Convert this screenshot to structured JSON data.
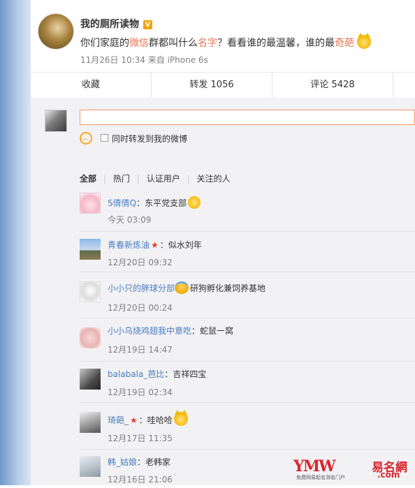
{
  "post": {
    "author": "我的厕所读物",
    "verified_badge": "V",
    "text_parts": [
      {
        "t": "你们家庭的",
        "hl": false
      },
      {
        "t": "微信",
        "hl": true
      },
      {
        "t": "群都叫什么",
        "hl": false
      },
      {
        "t": "名字",
        "hl": true
      },
      {
        "t": "？看看谁的最温馨，谁的最",
        "hl": false
      },
      {
        "t": "奇葩",
        "hl": true
      }
    ],
    "meta": "11月26日 10:34 来自 iPhone 6s",
    "actions": [
      "收藏",
      "转发 1056",
      "评论 5428"
    ]
  },
  "compose": {
    "input_value": "",
    "repost_label": "同时转发到我的微博",
    "repost_checked": false
  },
  "filters": {
    "items": [
      "全部",
      "热门",
      "认证用户",
      "关注的人"
    ],
    "active_index": 0
  },
  "comments": [
    {
      "name": "S倩倩Q",
      "text": "：东平党支部",
      "time": "今天 03:09",
      "emoji_after": "laugh-emoji",
      "star": false
    },
    {
      "name": "青春新炼油",
      "text": "：似水刘年",
      "time": "12月20日 09:32",
      "emoji_after": "",
      "star": true
    },
    {
      "name": "小小只的胖球分部",
      "text": "研狗孵化兼饲养基地",
      "time": "12月20日 00:24",
      "emoji_before": "hug-emoji",
      "star": false
    },
    {
      "name": "小小乌烧鸡翅我中意吃",
      "text": "：蛇鼠一窝",
      "time": "12月19日 14:47",
      "emoji_after": "",
      "star": false
    },
    {
      "name": "balabala_芭比",
      "text": "：吉祥四宝",
      "time": "12月19日 02:34",
      "emoji_after": "",
      "star": false
    },
    {
      "name": "琦葩_",
      "text": "：哇哈哈",
      "time": "12月17日 11:35",
      "emoji_after": "cat-emoji",
      "star": true
    },
    {
      "name": "韩_姑娘",
      "text": "：老韩家",
      "time": "12月16日 21:06",
      "emoji_after": "",
      "star": false
    }
  ],
  "watermark": {
    "main": "YMW",
    "cn": "易名網",
    "com": ".com",
    "sub": "免费网易起名测名门户"
  },
  "colors": {
    "link": "#4a7cbf",
    "highlight": "#eb7350",
    "input_border": "#f49864",
    "star": "#e5382c"
  }
}
